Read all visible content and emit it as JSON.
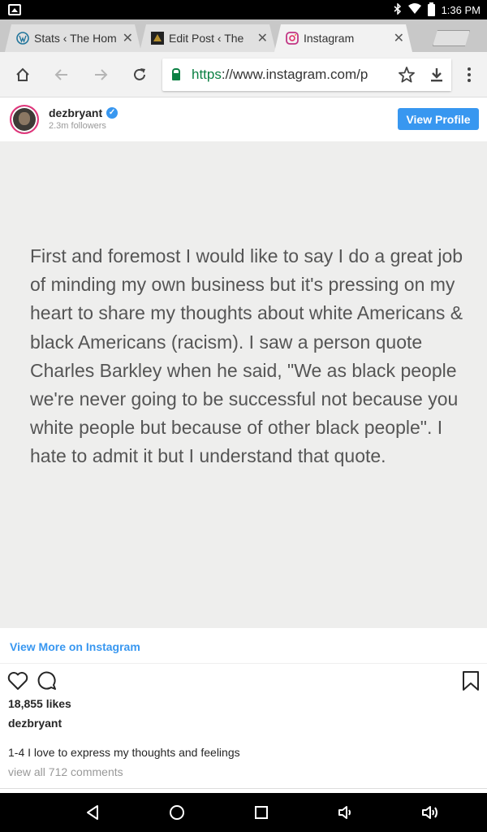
{
  "status_bar": {
    "time": "1:36 PM",
    "icons": [
      "gallery-icon",
      "bluetooth-icon",
      "wifi-icon",
      "battery-icon"
    ]
  },
  "browser": {
    "tabs": [
      {
        "title": "Stats ‹ The Hom",
        "favicon": "wordpress-icon",
        "active": false
      },
      {
        "title": "Edit Post ‹ The",
        "favicon": "site-icon",
        "active": false
      },
      {
        "title": "Instagram",
        "favicon": "instagram-icon",
        "active": true
      }
    ],
    "url_scheme": "https",
    "url_rest": "://www.instagram.com/p",
    "colors": {
      "secure": "#0b8043"
    }
  },
  "profile": {
    "username": "dezbryant",
    "followers": "2.3m followers",
    "view_profile_label": "View Profile"
  },
  "post": {
    "image_text": "First and foremost I would like to say I do a great job of minding my own business but it's pressing on my heart to share my thoughts about white Americans & black Americans (racism). I saw a person quote Charles Barkley when he said, \"We as black people we're never going to be successful not because you white people but because of other black people\". I hate to admit it but I understand that quote.",
    "view_more_label": "View More on Instagram",
    "likes": "18,855 likes",
    "caption_user": "dezbryant",
    "caption": "1-4 I love to express my thoughts and feelings",
    "comments_link": "view all 712 comments"
  },
  "colors": {
    "accent": "#3897f0",
    "text": "#262626",
    "muted": "#999999"
  }
}
